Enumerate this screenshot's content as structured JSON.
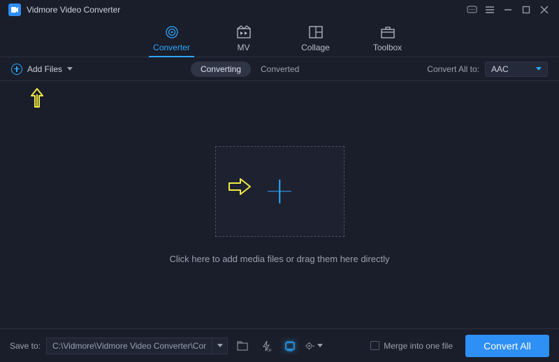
{
  "app": {
    "title": "Vidmore Video Converter"
  },
  "tabs": [
    {
      "label": "Converter",
      "active": true
    },
    {
      "label": "MV",
      "active": false
    },
    {
      "label": "Collage",
      "active": false
    },
    {
      "label": "Toolbox",
      "active": false
    }
  ],
  "secondary": {
    "add_files_label": "Add Files",
    "conv_tabs": {
      "converting": "Converting",
      "converted": "Converted"
    },
    "convert_all_to_label": "Convert All to:",
    "format_selected": "AAC"
  },
  "main": {
    "drop_hint": "Click here to add media files or drag them here directly"
  },
  "footer": {
    "save_to_label": "Save to:",
    "save_path": "C:\\Vidmore\\Vidmore Video Converter\\Converted",
    "merge_label": "Merge into one file",
    "convert_button": "Convert All"
  }
}
